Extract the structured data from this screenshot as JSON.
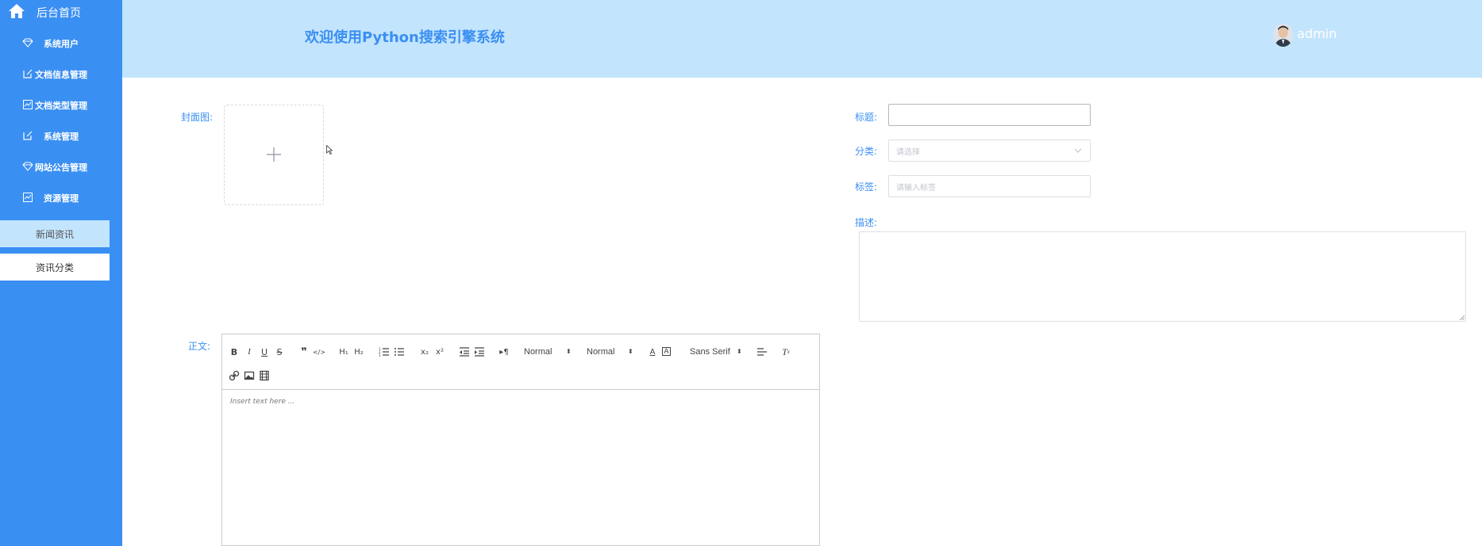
{
  "sidebar": {
    "home_label": "后台首页",
    "items": [
      {
        "label": "系统用户",
        "icon": "diamond-icon"
      },
      {
        "label": "文档信息管理",
        "icon": "edit-icon"
      },
      {
        "label": "文档类型管理",
        "icon": "chart-icon"
      },
      {
        "label": "系统管理",
        "icon": "edit-icon"
      },
      {
        "label": "网站公告管理",
        "icon": "diamond-icon"
      },
      {
        "label": "资源管理",
        "icon": "chart-icon"
      }
    ],
    "sub_items": [
      {
        "label": "新闻资讯",
        "active": true
      },
      {
        "label": "资讯分类",
        "active": false
      }
    ],
    "accent_color": "#3a8ff2",
    "active_sub_bg": "#c3e4fd"
  },
  "header": {
    "title": "欢迎使用Python搜索引擎系统",
    "username": "admin",
    "background": "#c3e4fd"
  },
  "form": {
    "cover_label": "封面图:",
    "title_label": "标题:",
    "title_value": "",
    "category_label": "分类:",
    "category_placeholder": "请选择",
    "tags_label": "标签:",
    "tags_placeholder": "请输入标签",
    "description_label": "描述:",
    "description_value": "",
    "content_label": "正文:"
  },
  "editor": {
    "size_picker": "Normal",
    "header_picker": "Normal",
    "font_picker": "Sans Serif",
    "placeholder": "Insert text here ..."
  }
}
